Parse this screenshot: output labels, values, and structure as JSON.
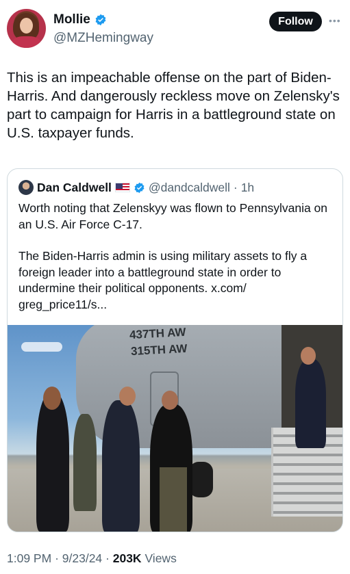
{
  "post": {
    "author_name": "Mollie",
    "author_handle": "@MZHemingway",
    "follow_label": "Follow",
    "more_icon": "more-options-icon",
    "text": "This is an impeachable offense on the part of Biden-Harris. And dangerously reckless move on Zelensky's part to campaign for Harris in a battleground state on U.S. taxpayer funds."
  },
  "quote": {
    "author_name": "Dan Caldwell",
    "author_handle": "@dandcaldwell",
    "time": "1h",
    "paragraph1": "Worth noting that Zelenskyy was flown to Pennsylvania on an U.S. Air Force C-17.",
    "paragraph2": "The Biden-Harris admin is using military assets to fly a foreign leader into a battleground state in order to undermine their political opponents. x.com/ greg_price11/s...",
    "photo": {
      "tail_text_1": "437TH AW",
      "tail_text_2": "315TH AW"
    }
  },
  "meta": {
    "time": "1:09 PM",
    "date": "9/23/24",
    "views_count": "203K",
    "views_label": "Views"
  },
  "colors": {
    "verified": "#1d9bf0",
    "text": "#0f1419",
    "secondary": "#536471",
    "border": "#cfd9de"
  }
}
